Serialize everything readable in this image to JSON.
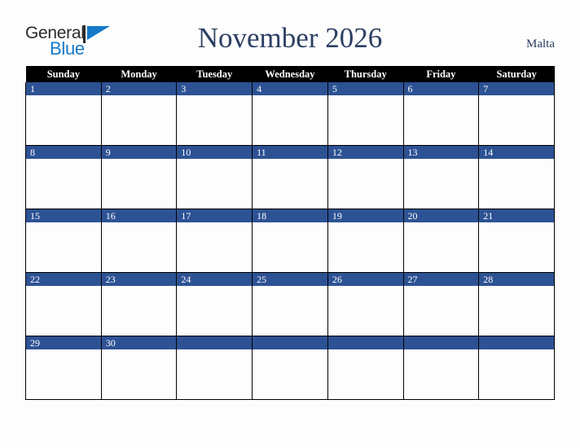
{
  "brand": {
    "name_part1": "General",
    "name_part2": "Blue",
    "mark": "triangle-mark"
  },
  "header": {
    "title": "November 2026",
    "country": "Malta"
  },
  "colors": {
    "accent_blue": "#2d5294",
    "brand_blue": "#1479c9",
    "title_navy": "#2c3f63",
    "header_bar": "#000000",
    "page_background": "#fdfdfd"
  },
  "calendar": {
    "month": "November",
    "year": "2026",
    "weekday_headers": [
      "Sunday",
      "Monday",
      "Tuesday",
      "Wednesday",
      "Thursday",
      "Friday",
      "Saturday"
    ],
    "weeks": [
      [
        {
          "day": "1",
          "note": ""
        },
        {
          "day": "2",
          "note": ""
        },
        {
          "day": "3",
          "note": ""
        },
        {
          "day": "4",
          "note": ""
        },
        {
          "day": "5",
          "note": ""
        },
        {
          "day": "6",
          "note": ""
        },
        {
          "day": "7",
          "note": ""
        }
      ],
      [
        {
          "day": "8",
          "note": ""
        },
        {
          "day": "9",
          "note": ""
        },
        {
          "day": "10",
          "note": ""
        },
        {
          "day": "11",
          "note": ""
        },
        {
          "day": "12",
          "note": ""
        },
        {
          "day": "13",
          "note": ""
        },
        {
          "day": "14",
          "note": ""
        }
      ],
      [
        {
          "day": "15",
          "note": ""
        },
        {
          "day": "16",
          "note": ""
        },
        {
          "day": "17",
          "note": ""
        },
        {
          "day": "18",
          "note": ""
        },
        {
          "day": "19",
          "note": ""
        },
        {
          "day": "20",
          "note": ""
        },
        {
          "day": "21",
          "note": ""
        }
      ],
      [
        {
          "day": "22",
          "note": ""
        },
        {
          "day": "23",
          "note": ""
        },
        {
          "day": "24",
          "note": ""
        },
        {
          "day": "25",
          "note": ""
        },
        {
          "day": "26",
          "note": ""
        },
        {
          "day": "27",
          "note": ""
        },
        {
          "day": "28",
          "note": ""
        }
      ],
      [
        {
          "day": "29",
          "note": ""
        },
        {
          "day": "30",
          "note": ""
        },
        {
          "day": "",
          "note": ""
        },
        {
          "day": "",
          "note": ""
        },
        {
          "day": "",
          "note": ""
        },
        {
          "day": "",
          "note": ""
        },
        {
          "day": "",
          "note": ""
        }
      ]
    ]
  }
}
